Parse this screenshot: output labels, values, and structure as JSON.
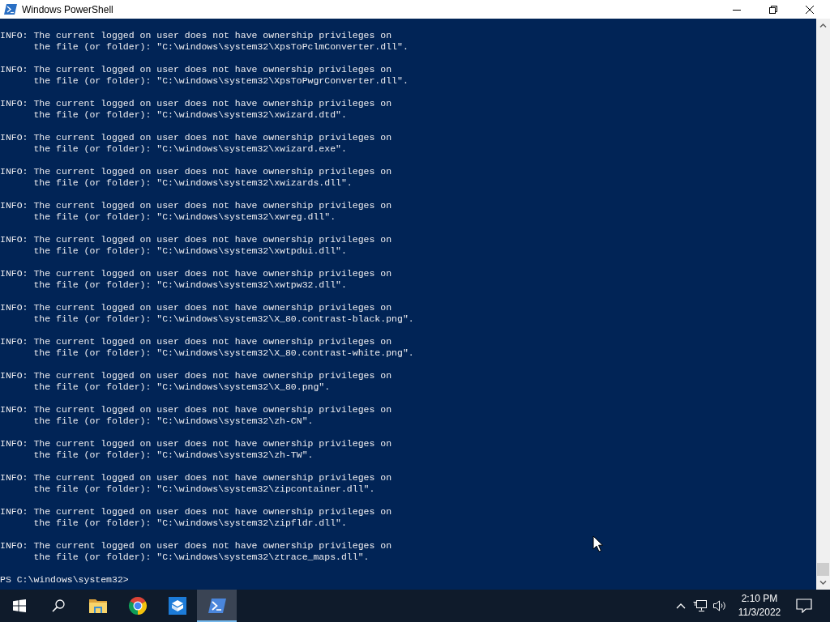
{
  "window": {
    "title": "Windows PowerShell"
  },
  "console": {
    "entries": [
      {
        "lines": [
          "INFO: The current logged on user does not have ownership privileges on",
          "the file (or folder): \"C:\\windows\\system32\\XpsToPclmConverter.dll\"."
        ]
      },
      {
        "lines": [
          "INFO: The current logged on user does not have ownership privileges on",
          "the file (or folder): \"C:\\windows\\system32\\XpsToPwgrConverter.dll\"."
        ]
      },
      {
        "lines": [
          "INFO: The current logged on user does not have ownership privileges on",
          "the file (or folder): \"C:\\windows\\system32\\xwizard.dtd\"."
        ]
      },
      {
        "lines": [
          "INFO: The current logged on user does not have ownership privileges on",
          "the file (or folder): \"C:\\windows\\system32\\xwizard.exe\"."
        ]
      },
      {
        "lines": [
          "INFO: The current logged on user does not have ownership privileges on",
          "the file (or folder): \"C:\\windows\\system32\\xwizards.dll\"."
        ]
      },
      {
        "lines": [
          "INFO: The current logged on user does not have ownership privileges on",
          "the file (or folder): \"C:\\windows\\system32\\xwreg.dll\"."
        ]
      },
      {
        "lines": [
          "INFO: The current logged on user does not have ownership privileges on",
          "the file (or folder): \"C:\\windows\\system32\\xwtpdui.dll\"."
        ]
      },
      {
        "lines": [
          "INFO: The current logged on user does not have ownership privileges on",
          "the file (or folder): \"C:\\windows\\system32\\xwtpw32.dll\"."
        ]
      },
      {
        "lines": [
          "INFO: The current logged on user does not have ownership privileges on",
          "the file (or folder): \"C:\\windows\\system32\\X_80.contrast-black.png\"."
        ]
      },
      {
        "lines": [
          "INFO: The current logged on user does not have ownership privileges on",
          "the file (or folder): \"C:\\windows\\system32\\X_80.contrast-white.png\"."
        ]
      },
      {
        "lines": [
          "INFO: The current logged on user does not have ownership privileges on",
          "the file (or folder): \"C:\\windows\\system32\\X_80.png\"."
        ]
      },
      {
        "lines": [
          "INFO: The current logged on user does not have ownership privileges on",
          "the file (or folder): \"C:\\windows\\system32\\zh-CN\"."
        ]
      },
      {
        "lines": [
          "INFO: The current logged on user does not have ownership privileges on",
          "the file (or folder): \"C:\\windows\\system32\\zh-TW\"."
        ]
      },
      {
        "lines": [
          "INFO: The current logged on user does not have ownership privileges on",
          "the file (or folder): \"C:\\windows\\system32\\zipcontainer.dll\"."
        ]
      },
      {
        "lines": [
          "INFO: The current logged on user does not have ownership privileges on",
          "the file (or folder): \"C:\\windows\\system32\\zipfldr.dll\"."
        ]
      },
      {
        "lines": [
          "INFO: The current logged on user does not have ownership privileges on",
          "the file (or folder): \"C:\\windows\\system32\\ztrace_maps.dll\"."
        ]
      }
    ],
    "prompt": "PS C:\\windows\\system32>"
  },
  "taskbar": {
    "buttons": [
      {
        "kind": "start"
      },
      {
        "kind": "search"
      }
    ],
    "apps": [
      {
        "kind": "folder",
        "selected": false
      },
      {
        "kind": "browser",
        "selected": false
      },
      {
        "kind": "box",
        "selected": false
      },
      {
        "kind": "terminal",
        "selected": true
      }
    ],
    "tray": [
      {
        "kind": "chevron"
      },
      {
        "kind": "network"
      },
      {
        "kind": "volume"
      }
    ],
    "clock": {
      "time": "2:10 PM",
      "date": "11/3/2022"
    }
  }
}
